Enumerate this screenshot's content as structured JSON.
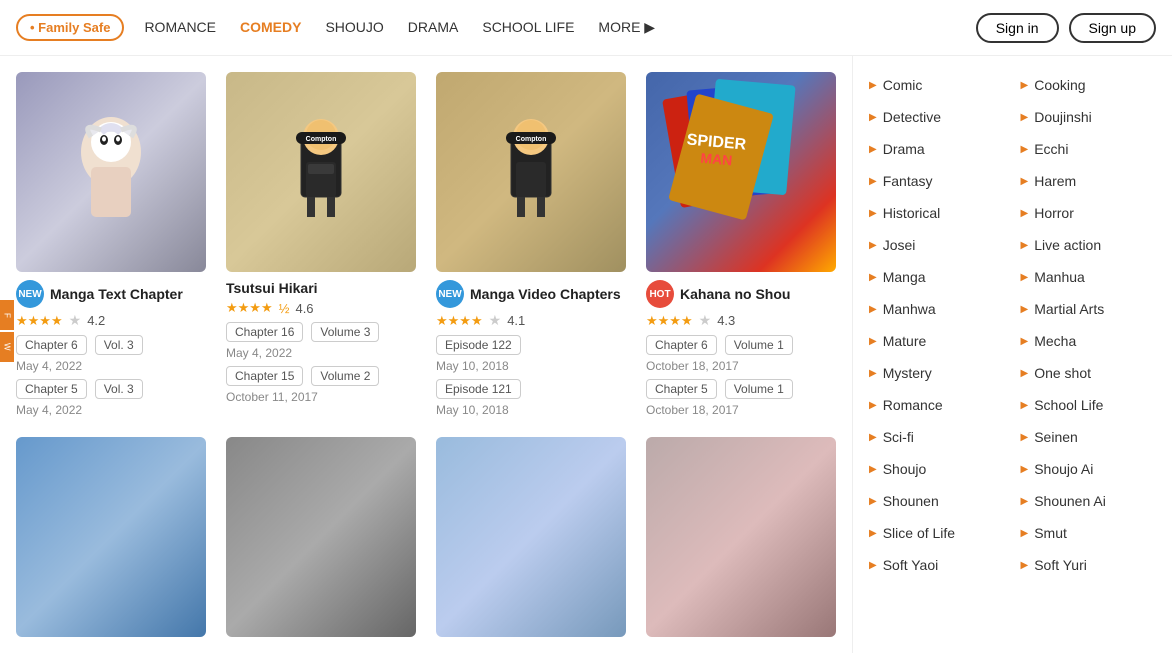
{
  "navbar": {
    "family_safe_label": "Family Safe",
    "links": [
      {
        "label": "ROMANCE",
        "active": false
      },
      {
        "label": "COMEDY",
        "active": true
      },
      {
        "label": "SHOUJO",
        "active": false
      },
      {
        "label": "DRAMA",
        "active": false
      },
      {
        "label": "SCHOOL LIFE",
        "active": false
      },
      {
        "label": "MORE ▶",
        "active": false
      }
    ],
    "sign_in_label": "Sign in",
    "sign_up_label": "Sign up"
  },
  "cards": [
    {
      "id": 1,
      "badge": "NEW",
      "badge_type": "new",
      "title": "Manga Text Chapter",
      "rating": 4.2,
      "stars_full": 4,
      "stars_empty": 1,
      "tags": [
        {
          "label": "Chapter 6"
        },
        {
          "label": "Vol. 3"
        }
      ],
      "date1": "May 4, 2022",
      "tags2": [
        {
          "label": "Chapter 5"
        },
        {
          "label": "Vol. 3"
        }
      ],
      "date2": "May 4, 2022",
      "bg_color": "#b8b8c8"
    },
    {
      "id": 2,
      "badge": "",
      "badge_type": "",
      "title": "Tsutsui Hikari",
      "rating": 4.6,
      "stars_full": 4,
      "stars_half": true,
      "stars_empty": 0,
      "tags": [
        {
          "label": "Chapter 16"
        },
        {
          "label": "Volume 3"
        }
      ],
      "date1": "May 4, 2022",
      "tags2": [
        {
          "label": "Chapter 15"
        },
        {
          "label": "Volume 2"
        }
      ],
      "date2": "October 11, 2017",
      "bg_color": "#d4c4a0"
    },
    {
      "id": 3,
      "badge": "NEW",
      "badge_type": "new",
      "title": "Manga Video Chapters",
      "rating": 4.1,
      "stars_full": 4,
      "stars_empty": 1,
      "tags": [
        {
          "label": "Episode 122"
        }
      ],
      "date1": "May 10, 2018",
      "tags2": [
        {
          "label": "Episode 121"
        }
      ],
      "date2": "May 10, 2018",
      "bg_color": "#c8b888"
    },
    {
      "id": 4,
      "badge": "HOT",
      "badge_type": "hot",
      "title": "Kahana no Shou",
      "rating": 4.3,
      "stars_full": 4,
      "stars_empty": 1,
      "tags": [
        {
          "label": "Chapter 6"
        },
        {
          "label": "Volume 1"
        }
      ],
      "date1": "October 18, 2017",
      "tags2": [
        {
          "label": "Chapter 5"
        },
        {
          "label": "Volume 1"
        }
      ],
      "date2": "October 18, 2017",
      "bg_color": "#6688aa"
    }
  ],
  "genres": {
    "col1": [
      "Comic",
      "Detective",
      "Drama",
      "Fantasy",
      "Historical",
      "Josei",
      "Manga",
      "Manhwa",
      "Mature",
      "Mystery",
      "Romance",
      "Sci-fi",
      "Shoujo",
      "Shounen",
      "Slice of Life",
      "Soft Yaoi"
    ],
    "col2": [
      "Cooking",
      "Doujinshi",
      "Ecchi",
      "Harem",
      "Horror",
      "Live action",
      "Manhua",
      "Martial Arts",
      "Mecha",
      "One shot",
      "School Life",
      "Seinen",
      "Shoujo Ai",
      "Shounen Ai",
      "Smut",
      "Soft Yuri"
    ]
  },
  "thumbs": {
    "card1_desc": "anime girl white hair",
    "card2_desc": "funko pop figure compton hat",
    "card3_desc": "funko pop figure compton hat 2",
    "card4_desc": "spider-man comics stack"
  },
  "left_bars": [
    "F",
    "W"
  ]
}
